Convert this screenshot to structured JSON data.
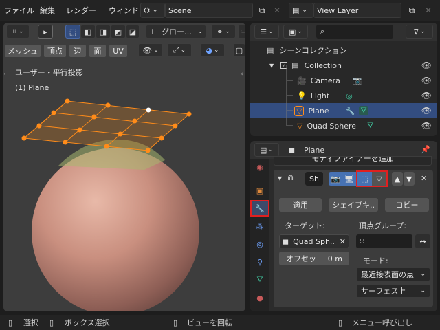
{
  "menu": [
    "ファイル",
    "編集",
    "レンダー",
    "ウィンド"
  ],
  "scene": {
    "label": "Scene"
  },
  "view_layer": {
    "label": "View Layer"
  },
  "viewport": {
    "transform_dropdown": "グロー…",
    "mode_buttons": [
      "メッシュ",
      "頂点",
      "辺",
      "面",
      "UV"
    ],
    "overlay_title": "ユーザー・平行投影",
    "overlay_object": "(1) Plane"
  },
  "outliner": {
    "scene_collection": "シーンコレクション",
    "items": [
      {
        "label": "Collection",
        "type": "collection"
      },
      {
        "label": "Camera",
        "type": "camera"
      },
      {
        "label": "Light",
        "type": "light"
      },
      {
        "label": "Plane",
        "type": "mesh",
        "selected": true
      },
      {
        "label": "Quad Sphere",
        "type": "mesh"
      }
    ]
  },
  "properties": {
    "object_name": "Plane",
    "add_modifier": "モディファイアーを追加",
    "modifier_name": "Sh",
    "apply": "適用",
    "shape_key": "シェイプキ..",
    "copy": "コピー",
    "target_label": "ターゲット:",
    "target_value": "Quad Sph..",
    "vgroup_label": "頂点グループ:",
    "offset_label": "オフセッ",
    "offset_value": "0 m",
    "mode_label": "モード:",
    "mode_value": "最近接表面の点",
    "surface_value": "サーフェス上"
  },
  "status": {
    "select": "選択",
    "box_select": "ボックス選択",
    "rotate_view": "ビューを回転",
    "call_menu": "メニュー呼び出し"
  },
  "colors": {
    "accent_orange": "#ff8c1a",
    "highlight_red": "#e02020",
    "selection_blue": "#334d80"
  }
}
